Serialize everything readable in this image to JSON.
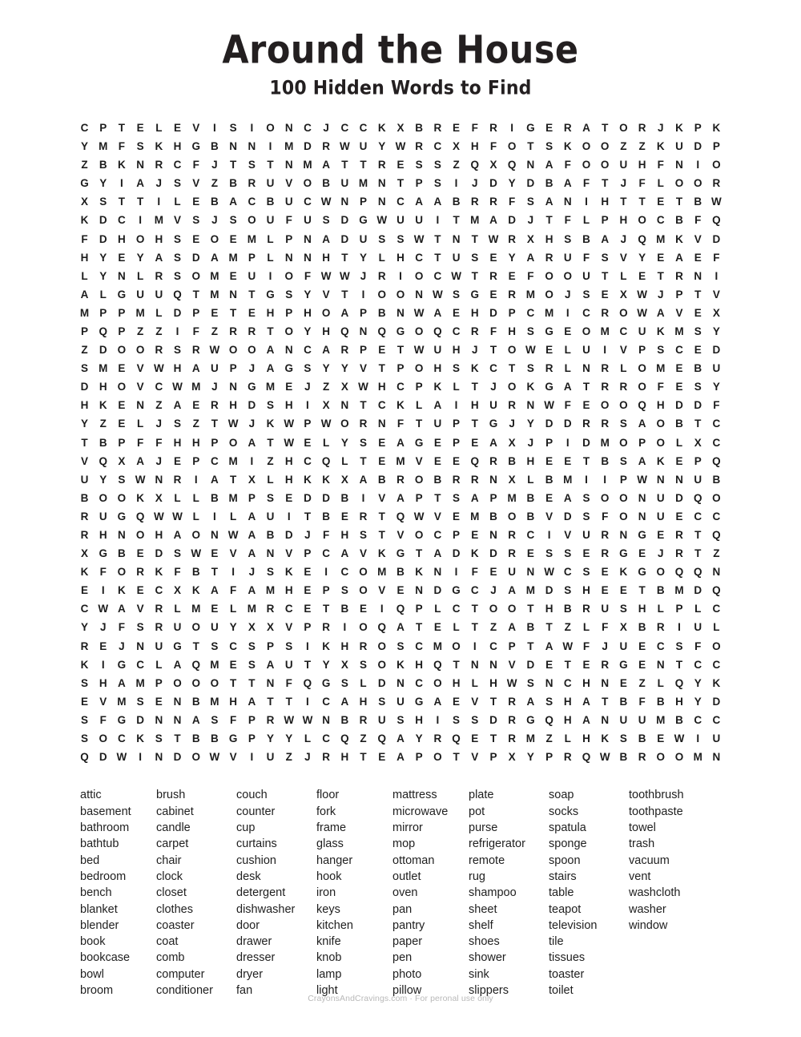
{
  "header": {
    "title": "Around the House",
    "subtitle": "100 Hidden Words to Find"
  },
  "footer": {
    "credit": "CrayonsAndCravings.com · For peronal use only"
  },
  "puzzle": {
    "rows": 35,
    "columns": 34,
    "grid": [
      "CPTELEVISIONCJCCKXBREFRIGERATORJKPK",
      "YMFSKHGBNNIMDRWUYWRCXHFOTSKOOZZKUDP",
      "ZBKNRCFJTSTNMATTRESSZQXQNAFOOUHFNIO",
      "GYIAJSVZBRUVOBUMNTPSIJDYDBAFTJFLOOR",
      "XSTTILEBACBUCWNPNCAABRRFSANIHTTETBW",
      "KDCIMVSJSOUFUSDGWUUITMADJTFLPHOCBFQ",
      "FDHOHSEOEMLPNADUSSWTNTWRXHSBAJQMKVD",
      "HYEYASDAMPLNNHTYLHCTUSEYARUFSVYEAEF",
      "LYNLRSOMEUIOFWWJRIOCWTREFOOUTLETRNI",
      "ALGUUQTMNTGSYVTIOONWSGERMOJSEXWJPTV",
      "MPPMLDPETEHPHOAPBNWAEHDPCMICROWAVEX",
      "PQPZZIFZRRTOYHQNQGOQCRFHSGEOMCUKMSY",
      "ZDOORSRWOOANCARPETWUHJTOWELUIVPSCED",
      "SMEVWHAUPJAGSYYVTPOHSKCTSRLNRLOMEBU",
      "DHOVCWMJNGMEJZXWHCPKLTJOKGATRROFESY",
      "HKENZAERHDSHIXNTCKLAIHURNWFEOOQHDDF",
      "YZELJSZTWJKWPWORNFTUPTGJYDDRRSAOBTC",
      "TBPFFHHPOATWELYSEAGEPEAXJPIDMOPOLXC",
      "VQXAJEPCMIZHCQLTEMVEEQRBHEETBSAKEPQ",
      "UYSWNRIATXLHKKXABROBRRNXLBMIIPWNNUB",
      "BOOKXLLBMPSEDDBIVAPTSAPMBEASOONUDQO",
      "RUGQWWLILAUITBERTQWVEMBOBVDSFONUECC",
      "RHNOHAONWABDJFHSTVOCPENRCIVURNGERTQ",
      "XGBEDSWEVANVPCAVKGTADKDRESSERGEJRTZ",
      "KFORKFBTIJSKEICOMBKNIFEUNWCSEKGOQQN",
      "EIKECXKAFAMHEPSOVENDGCJAMDSHEETBMDQ",
      "CWAVRLMELMRCETBEIQPLCTOOTHBRUSHLPLC",
      "YJFSRUOUYXXVPRIOQATELTZABTZLFXBRIUL",
      "REJNUGTSCSPSIKHROSCMOICPTAWFJUECSFO",
      "KIGCLAQMESAUTYXSOKHQTNNVDETERGENTCC",
      "SHAMPOOOTTNFQGSLDNCOHLHWSNCHNEZLQYK",
      "EVMSENBMHATTICAHSUGAEVTRASHATBFBHYD",
      "SFGDNNASFPRWWNBRUSHISSDRGQHANUUMBCC",
      "SOCKSTBBGPYYLCQZQAYRQETRMZLHKSBEWIU",
      "QDWINDOWVIUZJRHTEAPOTVPXYPRQWBROOMN"
    ]
  },
  "wordlist": {
    "columns": [
      [
        "attic",
        "basement",
        "bathroom",
        "bathtub",
        "bed",
        "bedroom",
        "bench",
        "blanket",
        "blender",
        "book",
        "bookcase",
        "bowl",
        "broom"
      ],
      [
        "brush",
        "cabinet",
        "candle",
        "carpet",
        "chair",
        "clock",
        "closet",
        "clothes",
        "coaster",
        "coat",
        "comb",
        "computer",
        "conditioner"
      ],
      [
        "couch",
        "counter",
        "cup",
        "curtains",
        "cushion",
        "desk",
        "detergent",
        "dishwasher",
        "door",
        "drawer",
        "dresser",
        "dryer",
        "fan"
      ],
      [
        "floor",
        "fork",
        "frame",
        "glass",
        "hanger",
        "hook",
        "iron",
        "keys",
        "kitchen",
        "knife",
        "knob",
        "lamp",
        "light"
      ],
      [
        "mattress",
        "microwave",
        "mirror",
        "mop",
        "ottoman",
        "outlet",
        "oven",
        "pan",
        "pantry",
        "paper",
        "pen",
        "photo",
        "pillow"
      ],
      [
        "plate",
        "pot",
        "purse",
        "refrigerator",
        "remote",
        "rug",
        "shampoo",
        "sheet",
        "shelf",
        "shoes",
        "shower",
        "sink",
        "slippers"
      ],
      [
        "soap",
        "socks",
        "spatula",
        "sponge",
        "spoon",
        "stairs",
        "table",
        "teapot",
        "television",
        "tile",
        "tissues",
        "toaster",
        "toilet"
      ],
      [
        "toothbrush",
        "toothpaste",
        "towel",
        "trash",
        "vacuum",
        "vent",
        "washcloth",
        "washer",
        "window"
      ]
    ]
  }
}
